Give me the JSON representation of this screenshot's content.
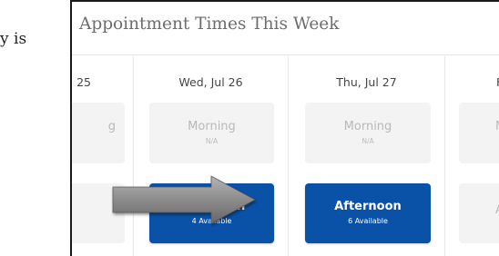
{
  "left_text": "y is",
  "panel": {
    "title": "Appointment Times This Week"
  },
  "days": [
    {
      "date": "25",
      "morning": {
        "label": "g",
        "sub": ""
      },
      "afternoon": {
        "label": "",
        "sub": ""
      }
    },
    {
      "date": "Wed, Jul 26",
      "morning": {
        "label": "Morning",
        "sub": "N/A"
      },
      "afternoon": {
        "label": "Afternoon",
        "sub": "4 Available"
      }
    },
    {
      "date": "Thu, Jul 27",
      "morning": {
        "label": "Morning",
        "sub": "N/A"
      },
      "afternoon": {
        "label": "Afternoon",
        "sub": "6 Available"
      }
    },
    {
      "date": "F",
      "morning": {
        "label": "M",
        "sub": ""
      },
      "afternoon": {
        "label": "Af",
        "sub": ""
      }
    }
  ],
  "colors": {
    "available_slot": "#0a51a8",
    "unavailable_slot": "#f3f3f3",
    "arrow": "#8a8a8a"
  },
  "icons": {
    "pointer": "right-arrow-icon"
  }
}
